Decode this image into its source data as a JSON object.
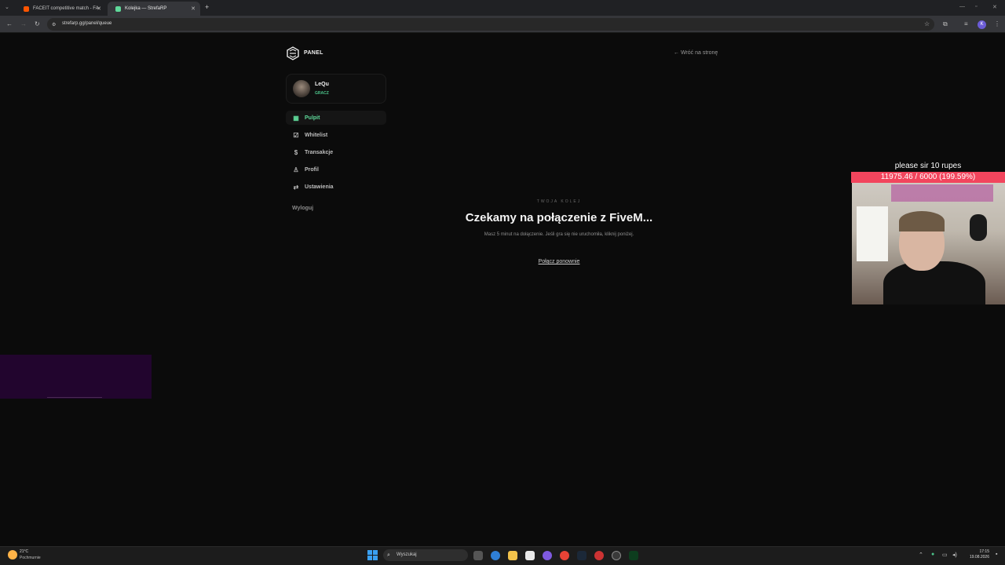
{
  "browser": {
    "tabs": [
      {
        "label": "FACEIT competitive match - FA",
        "favicon_color": "#ff5500"
      },
      {
        "label": "Kolejka — StrefaRP",
        "favicon_color": "#5fd99a"
      }
    ],
    "new_tab_glyph": "+",
    "close_glyph": "✕",
    "url": "strefarp.gg/panel/queue",
    "profile_initial": "K"
  },
  "panel": {
    "title": "PANEL",
    "back_link": "← Wróć na stronę",
    "user": {
      "name": "LeQu",
      "role": "GRACZ"
    },
    "nav": [
      {
        "label": "Pulpit",
        "icon": "grid-icon",
        "glyph": "▦"
      },
      {
        "label": "Whitelist",
        "icon": "checkbox-icon",
        "glyph": "☑"
      },
      {
        "label": "Transakcje",
        "icon": "dollar-icon",
        "glyph": "$"
      },
      {
        "label": "Profil",
        "icon": "user-icon",
        "glyph": "♙"
      },
      {
        "label": "Ustawienia",
        "icon": "sliders-icon",
        "glyph": "⇄"
      }
    ],
    "logout": "Wyloguj"
  },
  "queue": {
    "eyebrow": "TWOJA KOLEJ",
    "title": "Czekamy na połączenie z FiveM...",
    "description": "Masz 5 minut na dołączenie. Jeśli gra się nie uruchomiła, kliknij poniżej.",
    "reconnect_link": "Połącz ponownie"
  },
  "stream_overlay": {
    "title": "please sir 10 rupes",
    "goal": "11975.46 / 6000 (199.59%)",
    "accent": "#f2455d"
  },
  "taskbar": {
    "weather_temp": "21°C",
    "weather_desc": "Pochmurnie",
    "search_placeholder": "Wyszukaj",
    "time": "17:15",
    "date": "19.08.2026"
  },
  "colors": {
    "accent_green": "#5fd99a",
    "background": "#0b0b0b"
  }
}
